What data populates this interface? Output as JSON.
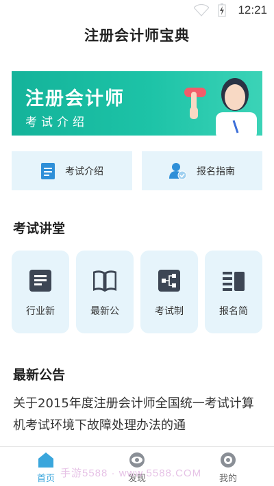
{
  "status_bar": {
    "time": "12:21",
    "icons": [
      "wifi-icon",
      "battery-icon"
    ]
  },
  "app": {
    "title": "注册会计师宝典"
  },
  "banner": {
    "title": "注册会计师",
    "subtitle": "考试介绍"
  },
  "quick_links": [
    {
      "label": "考试介绍",
      "icon": "document-icon"
    },
    {
      "label": "报名指南",
      "icon": "user-check-icon"
    }
  ],
  "sections": {
    "lectures": "考试讲堂",
    "announcements": "最新公告"
  },
  "tiles": [
    {
      "label": "行业新",
      "icon": "news-icon"
    },
    {
      "label": "最新公",
      "icon": "book-icon"
    },
    {
      "label": "考试制",
      "icon": "structure-icon"
    },
    {
      "label": "报名简",
      "icon": "list-icon"
    }
  ],
  "announcement": {
    "text": "关于2015年度注册会计师全国统一考试计算机考试环境下故障处理办法的通"
  },
  "tabbar": {
    "items": [
      {
        "label": "首页",
        "icon": "home-icon",
        "active": true
      },
      {
        "label": "发现",
        "icon": "eye-icon",
        "active": false
      },
      {
        "label": "我的",
        "icon": "profile-icon",
        "active": false
      }
    ]
  },
  "watermark": "手游5588 · www.5588.COM",
  "colors": {
    "accent": "#3aa6dc",
    "banner": "#1dc3a7",
    "tile_bg": "#e6f4fb",
    "icon_dark": "#3d4654"
  }
}
